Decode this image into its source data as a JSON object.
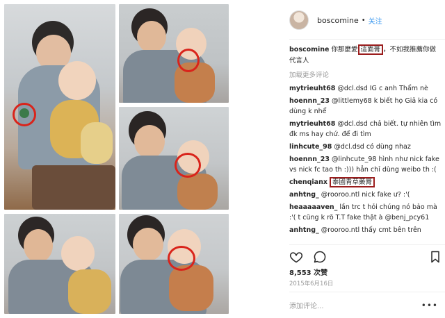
{
  "post": {
    "username": "boscomine",
    "separator": "•",
    "follow_label": "关注",
    "caption_user": "boscomine",
    "caption_pre": "你那麼愛",
    "caption_boxed": "這面膏",
    "caption_post": "，不如我推薦你做代言人",
    "load_more": "加载更多评论",
    "likes": "8,553 次赞",
    "date": "2015年6月16日",
    "add_comment": "添加评论...",
    "more_label": "•••"
  },
  "comments": [
    {
      "user": "mytrieuht68",
      "text": "@dcl.dsd IG c anh Thẩm nè"
    },
    {
      "user": "hoennn_23",
      "text": "@littlemy68 k biết họ Giả kia có dùng k nhể"
    },
    {
      "user": "mytrieuht68",
      "text": "@dcl.dsd chả biết. tự nhiên tìm đk ms hay chứ. để đi tìm"
    },
    {
      "user": "linhcute_98",
      "text": "@dcl.dsd có dùng nhaz"
    },
    {
      "user": "hoennn_23",
      "text": "@linhcute_98 hình như nick fake vs nick fc tao th :))) hẳn chỉ dùng weibo th :("
    },
    {
      "user": "chenqianx",
      "text": "泰國青草藥膏",
      "boxed": true
    },
    {
      "user": "anhtng_",
      "text": "@rooroo.ntl nick fake ư? :'("
    },
    {
      "user": "heaaaaaven_",
      "text": "lần trc t hỏi chúng nó bảo mà :'( t cũng k rõ T.T fake thật à @benj_pcy61"
    },
    {
      "user": "anhtng_",
      "text": "@rooroo.ntl thấy cmt bên trên"
    }
  ],
  "icons": {
    "like": "heart-icon",
    "comment": "comment-icon",
    "save": "bookmark-icon"
  },
  "colors": {
    "accent": "#3897f0",
    "highlight_box": "#9b1d1d",
    "circle_mark": "#d9241b"
  }
}
